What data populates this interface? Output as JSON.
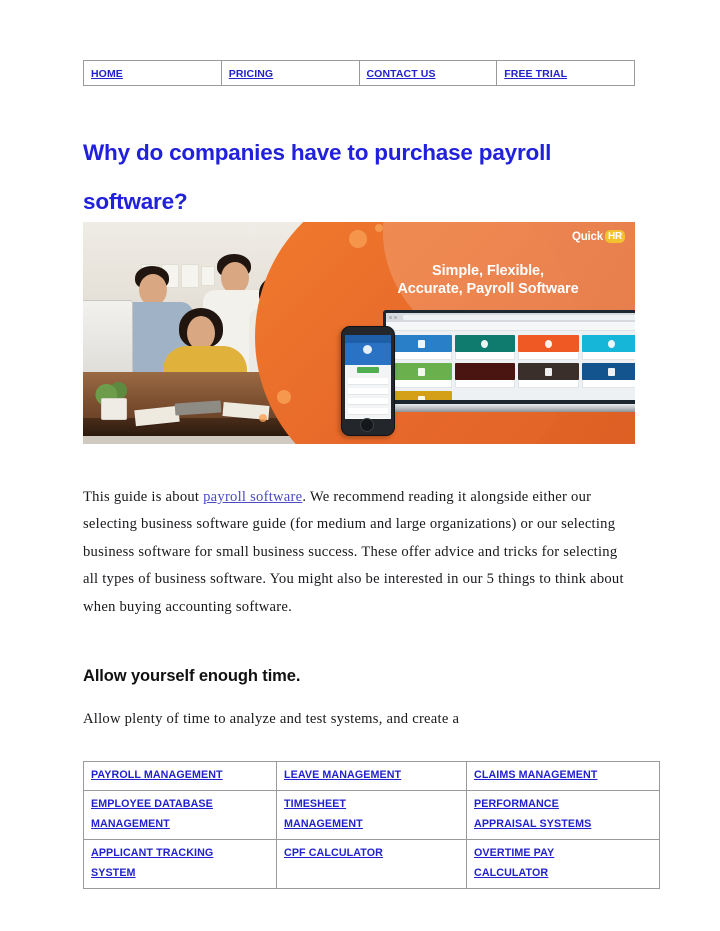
{
  "nav": {
    "items": [
      {
        "label": "HOME"
      },
      {
        "label": "PRICING"
      },
      {
        "label": "CONTACT US"
      },
      {
        "label": "FREE TRIAL"
      }
    ]
  },
  "article": {
    "title": "Why do companies have to purchase payroll software?",
    "paragraph_1_before_link": "This guide is about ",
    "paragraph_1_link": "payroll software",
    "paragraph_1_after_link": ". We recommend reading it alongside either our selecting business software guide (for medium and large organizations) or our selecting business software for small business success. These offer advice and tricks for selecting all types of business software. You might also be interested in our 5 things to think about when buying accounting software.",
    "subheading": "Allow yourself enough time.",
    "paragraph_2": "Allow plenty of time to analyze and test systems, and create a"
  },
  "banner": {
    "logo_name": "Quick",
    "logo_badge": "HR",
    "tagline_line_1": "Simple, Flexible,",
    "tagline_line_2": "Accurate, Payroll Software",
    "background_color": "#e8692a",
    "accent_color": "#f2c230"
  },
  "footer_links": {
    "rows": [
      [
        {
          "label": "PAYROLL MANAGEMENT",
          "lines": [
            "PAYROLL MANAGEMENT"
          ]
        },
        {
          "label": "LEAVE MANAGEMENT",
          "lines": [
            "LEAVE MANAGEMENT"
          ]
        },
        {
          "label": "CLAIMS MANAGEMENT",
          "lines": [
            "CLAIMS MANAGEMENT"
          ]
        }
      ],
      [
        {
          "label": "EMPLOYEE DATABASE MANAGEMENT",
          "lines": [
            "EMPLOYEE DATABASE",
            "MANAGEMENT"
          ]
        },
        {
          "label": "TIMESHEET MANAGEMENT",
          "lines": [
            "TIMESHEET",
            "MANAGEMENT"
          ]
        },
        {
          "label": "PERFORMANCE APPRAISAL SYSTEMS",
          "lines": [
            "PERFORMANCE",
            "APPRAISAL SYSTEMS"
          ]
        }
      ],
      [
        {
          "label": "APPLICANT TRACKING SYSTEM",
          "lines": [
            "APPLICANT TRACKING",
            "SYSTEM"
          ]
        },
        {
          "label": "CPF CALCULATOR",
          "lines": [
            "CPF CALCULATOR"
          ]
        },
        {
          "label": "OVERTIME PAY CALCULATOR",
          "lines": [
            "OVERTIME PAY",
            "CALCULATOR"
          ]
        }
      ]
    ]
  },
  "colors": {
    "link_blue": "#2222cc",
    "title_blue": "#2020dd",
    "inline_link": "#4b4bc4",
    "text": "#19181c"
  }
}
